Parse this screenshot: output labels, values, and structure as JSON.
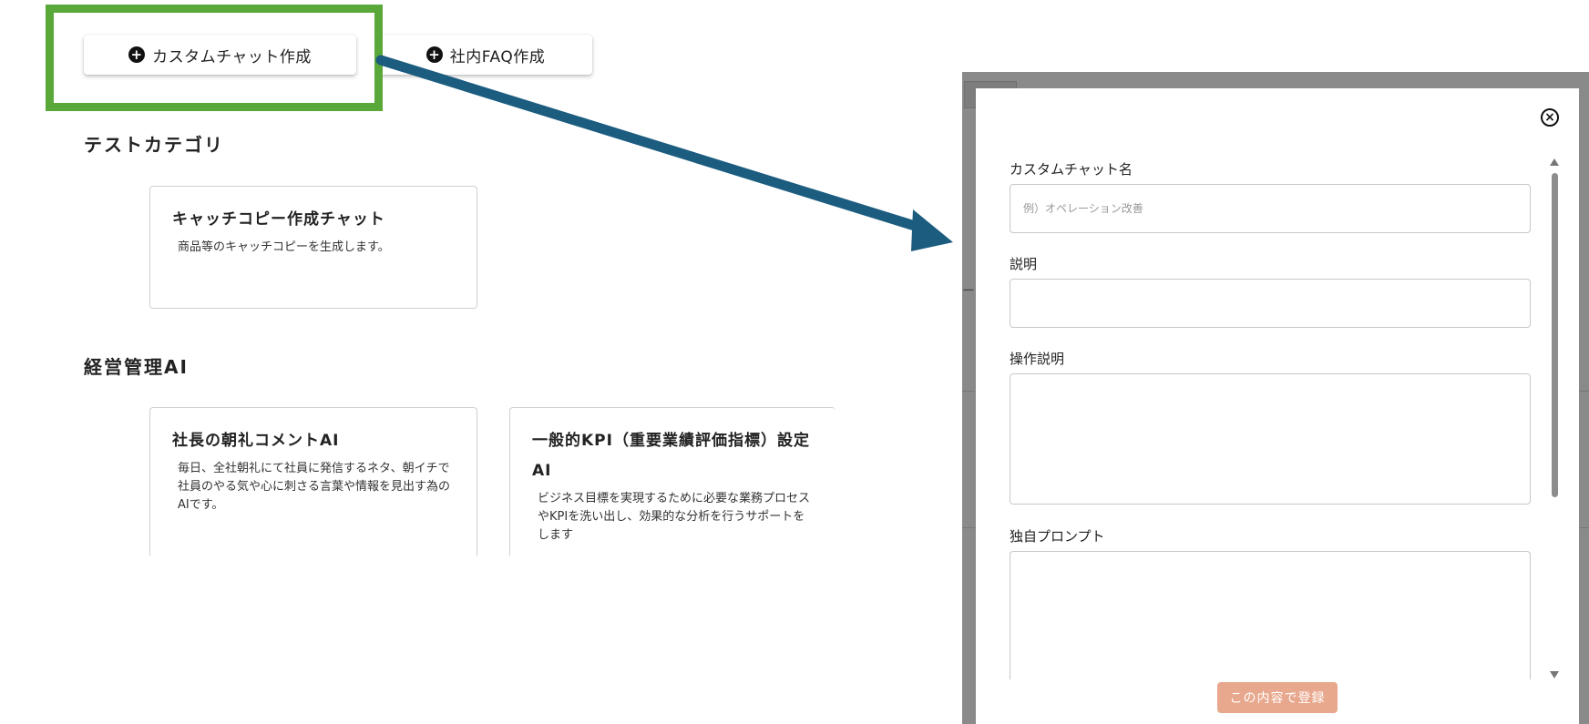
{
  "toolbar": {
    "custom_chat_button": "カスタムチャット作成",
    "faq_button": "社内FAQ作成"
  },
  "categories": [
    {
      "title": "テストカテゴリ",
      "cards": [
        {
          "title": "キャッチコピー作成チャット",
          "desc": "商品等のキャッチコピーを生成します。"
        }
      ]
    },
    {
      "title": "経営管理AI",
      "cards": [
        {
          "title": "社長の朝礼コメントAI",
          "desc": "毎日、全社朝礼にて社員に発信するネタ、朝イチで社員のやる気や心に刺さる言葉や情報を見出す為のAIです。"
        },
        {
          "title": "一般的KPI（重要業績評価指標）設定AI",
          "desc": "ビジネス目標を実現するために必要な業務プロセスやKPIを洗い出し、効果的な分析を行うサポートをします"
        }
      ]
    }
  ],
  "modal": {
    "fields": [
      {
        "label": "カスタムチャット名",
        "placeholder": "例）オペレーション改善",
        "value": ""
      },
      {
        "label": "説明",
        "value": ""
      },
      {
        "label": "操作説明",
        "value": ""
      },
      {
        "label": "独自プロンプト",
        "value": ""
      }
    ],
    "submit_label": "この内容で登録"
  },
  "colors": {
    "highlight": "#5aa83a",
    "arrow": "#1b5c7f",
    "submit": "#e8a88e",
    "overlay": "#8a8a8a"
  },
  "icons": [
    "plus-circle-icon",
    "close-circle-icon",
    "scroll-up-icon",
    "scroll-down-icon",
    "arrow-annotation"
  ]
}
